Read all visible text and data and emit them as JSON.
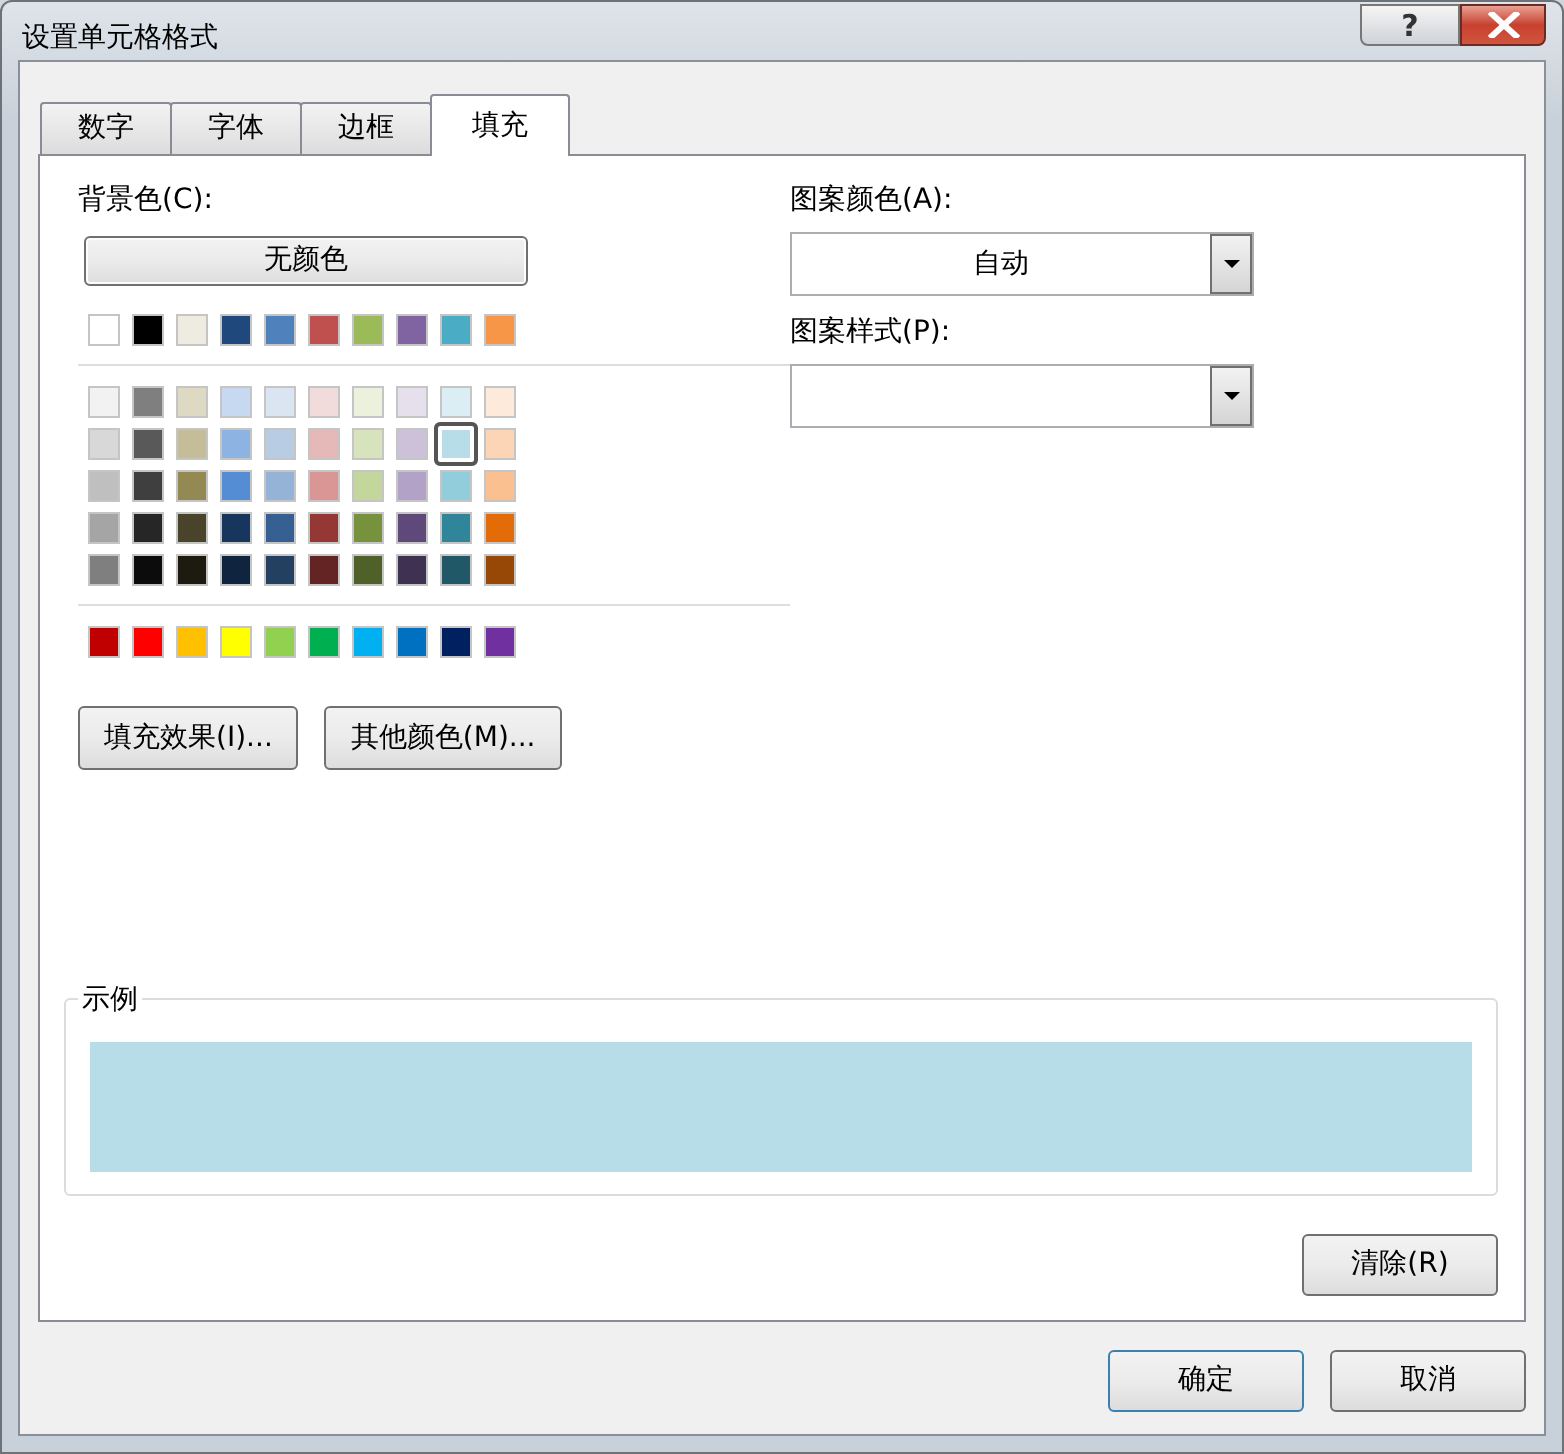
{
  "window": {
    "title": "设置单元格格式",
    "help_button": "?"
  },
  "tabs": [
    {
      "label": "数字",
      "selected": false
    },
    {
      "label": "字体",
      "selected": false
    },
    {
      "label": "边框",
      "selected": false
    },
    {
      "label": "填充",
      "selected": true
    }
  ],
  "background_color": {
    "label": "背景色(C):",
    "no_color_button": "无颜色",
    "palette": [
      {
        "rows": [
          [
            {
              "color": "#ffffff",
              "selected": false
            },
            {
              "color": "#000000",
              "selected": false
            },
            {
              "color": "#eeece1",
              "selected": false
            },
            {
              "color": "#1f497d",
              "selected": false
            },
            {
              "color": "#4f81bd",
              "selected": false
            },
            {
              "color": "#c0504d",
              "selected": false
            },
            {
              "color": "#9bbb59",
              "selected": false
            },
            {
              "color": "#8064a2",
              "selected": false
            },
            {
              "color": "#4bacc6",
              "selected": false
            },
            {
              "color": "#f79646",
              "selected": false
            }
          ]
        ]
      },
      {
        "rows": [
          [
            {
              "color": "#f2f2f2",
              "selected": false
            },
            {
              "color": "#7f7f7f",
              "selected": false
            },
            {
              "color": "#ddd9c3",
              "selected": false
            },
            {
              "color": "#c6d9f0",
              "selected": false
            },
            {
              "color": "#dbe5f1",
              "selected": false
            },
            {
              "color": "#f2dcdb",
              "selected": false
            },
            {
              "color": "#ebf1dd",
              "selected": false
            },
            {
              "color": "#e5e0ec",
              "selected": false
            },
            {
              "color": "#dbeef3",
              "selected": false
            },
            {
              "color": "#fdeada",
              "selected": false
            }
          ],
          [
            {
              "color": "#d8d8d8",
              "selected": false
            },
            {
              "color": "#595959",
              "selected": false
            },
            {
              "color": "#c4bd97",
              "selected": false
            },
            {
              "color": "#8db3e2",
              "selected": false
            },
            {
              "color": "#b8cce4",
              "selected": false
            },
            {
              "color": "#e5b9b7",
              "selected": false
            },
            {
              "color": "#d7e3bc",
              "selected": false
            },
            {
              "color": "#ccc1d9",
              "selected": false
            },
            {
              "color": "#b7dde8",
              "selected": true
            },
            {
              "color": "#fbd5b5",
              "selected": false
            }
          ],
          [
            {
              "color": "#bfbfbf",
              "selected": false
            },
            {
              "color": "#3f3f3f",
              "selected": false
            },
            {
              "color": "#938953",
              "selected": false
            },
            {
              "color": "#548dd4",
              "selected": false
            },
            {
              "color": "#95b3d7",
              "selected": false
            },
            {
              "color": "#d99694",
              "selected": false
            },
            {
              "color": "#c3d69b",
              "selected": false
            },
            {
              "color": "#b2a2c7",
              "selected": false
            },
            {
              "color": "#92cddc",
              "selected": false
            },
            {
              "color": "#fac08f",
              "selected": false
            }
          ],
          [
            {
              "color": "#a5a5a5",
              "selected": false
            },
            {
              "color": "#262626",
              "selected": false
            },
            {
              "color": "#494429",
              "selected": false
            },
            {
              "color": "#17365d",
              "selected": false
            },
            {
              "color": "#366092",
              "selected": false
            },
            {
              "color": "#953734",
              "selected": false
            },
            {
              "color": "#76923c",
              "selected": false
            },
            {
              "color": "#5f497a",
              "selected": false
            },
            {
              "color": "#31859b",
              "selected": false
            },
            {
              "color": "#e36c09",
              "selected": false
            }
          ],
          [
            {
              "color": "#7f7f7f",
              "selected": false
            },
            {
              "color": "#0c0c0c",
              "selected": false
            },
            {
              "color": "#1d1b10",
              "selected": false
            },
            {
              "color": "#0f243e",
              "selected": false
            },
            {
              "color": "#244061",
              "selected": false
            },
            {
              "color": "#632423",
              "selected": false
            },
            {
              "color": "#4f6128",
              "selected": false
            },
            {
              "color": "#3f3151",
              "selected": false
            },
            {
              "color": "#205867",
              "selected": false
            },
            {
              "color": "#974806",
              "selected": false
            }
          ]
        ]
      },
      {
        "rows": [
          [
            {
              "color": "#c00000",
              "selected": false
            },
            {
              "color": "#ff0000",
              "selected": false
            },
            {
              "color": "#ffc000",
              "selected": false
            },
            {
              "color": "#ffff00",
              "selected": false
            },
            {
              "color": "#92d050",
              "selected": false
            },
            {
              "color": "#00b050",
              "selected": false
            },
            {
              "color": "#00b0f0",
              "selected": false
            },
            {
              "color": "#0070c0",
              "selected": false
            },
            {
              "color": "#002060",
              "selected": false
            },
            {
              "color": "#7030a0",
              "selected": false
            }
          ]
        ]
      }
    ],
    "buttons": [
      "填充效果(I)...",
      "其他颜色(M)..."
    ]
  },
  "pattern_color": {
    "label": "图案颜色(A):",
    "value": "自动"
  },
  "pattern_style": {
    "label": "图案样式(P):"
  },
  "sample": {
    "label": "示例",
    "color": "#b7dde8"
  },
  "clear_button": "清除(R)",
  "footer_buttons": [
    "确定",
    "取消"
  ]
}
